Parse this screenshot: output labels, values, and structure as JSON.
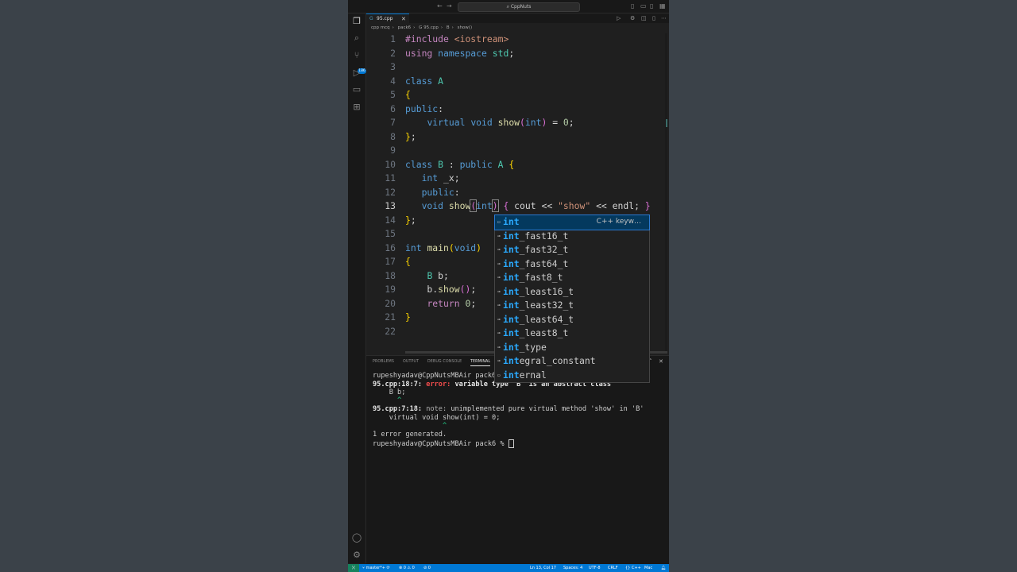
{
  "titlebar": {
    "search_text": "⌕ CppNuts"
  },
  "tab": {
    "label": "95.cpp",
    "close": "✕",
    "file_icon": "C++"
  },
  "breadcrumb": [
    "cpp mcq",
    "pack6",
    "G 95.cpp",
    "B",
    "show()"
  ],
  "editor": {
    "lines": [
      {
        "n": "1"
      },
      {
        "n": "2"
      },
      {
        "n": "3"
      },
      {
        "n": "4"
      },
      {
        "n": "5"
      },
      {
        "n": "6"
      },
      {
        "n": "7"
      },
      {
        "n": "8"
      },
      {
        "n": "9"
      },
      {
        "n": "10"
      },
      {
        "n": "11"
      },
      {
        "n": "12"
      },
      {
        "n": "13"
      },
      {
        "n": "14"
      },
      {
        "n": "15"
      },
      {
        "n": "16"
      },
      {
        "n": "17"
      },
      {
        "n": "18"
      },
      {
        "n": "19"
      },
      {
        "n": "20"
      },
      {
        "n": "21"
      },
      {
        "n": "22"
      }
    ]
  },
  "suggest": {
    "items": [
      {
        "match": "int",
        "rest": "",
        "detail": "C++ keyw…",
        "icon": "keyword-icon"
      },
      {
        "match": "int",
        "rest": "_fast16_t"
      },
      {
        "match": "int",
        "rest": "_fast32_t"
      },
      {
        "match": "int",
        "rest": "_fast64_t"
      },
      {
        "match": "int",
        "rest": "_fast8_t"
      },
      {
        "match": "int",
        "rest": "_least16_t"
      },
      {
        "match": "int",
        "rest": "_least32_t"
      },
      {
        "match": "int",
        "rest": "_least64_t"
      },
      {
        "match": "int",
        "rest": "_least8_t"
      },
      {
        "match": "int",
        "rest": "_type"
      },
      {
        "match": "int",
        "rest": "egral_constant"
      },
      {
        "match": "int",
        "rest": "ernal"
      }
    ]
  },
  "panel": {
    "tabs": [
      "PROBLEMS",
      "OUTPUT",
      "DEBUG CONSOLE",
      "TERMINAL"
    ],
    "active_tab": "TERMINAL"
  },
  "terminal": {
    "prompt1": "rupeshyadav@CppNutsMBAir pack6",
    "err_loc": "95.cpp:18:7: ",
    "err_label": "error: ",
    "err_msg": "variable type 'B' is an abstract class",
    "err_src": "    B b;",
    "err_caret": "      ^",
    "note_loc": "95.cpp:7:18: ",
    "note_label": "note: ",
    "note_msg": "unimplemented pure virtual method 'show' in 'B'",
    "note_src": "    virtual void show(int) = 0;",
    "note_caret": "                 ^",
    "summary": "1 error generated.",
    "prompt2": "rupeshyadav@CppNutsMBAir pack6 % "
  },
  "statusbar": {
    "branch": "master*+",
    "sync": "⟳",
    "problems": "⊗ 0 ⚠ 0",
    "ports": "⊘ 0",
    "position": "Ln 13, Col 17",
    "spaces": "Spaces: 4",
    "encoding": "UTF-8",
    "eol": "CRLF",
    "language": "{} C++",
    "platform": "Mac"
  },
  "colors": {
    "accent": "#0078d4",
    "remote": "#16825d",
    "error": "#f14c4c"
  }
}
